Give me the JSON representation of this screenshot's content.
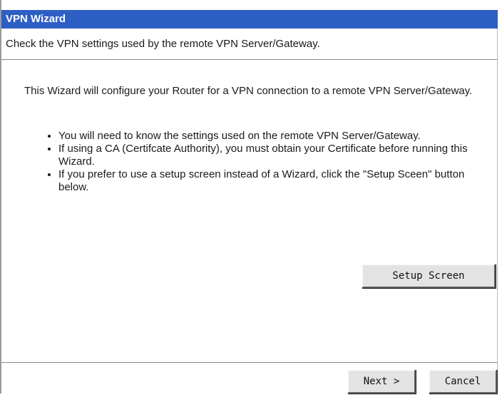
{
  "window": {
    "title": "VPN Wizard",
    "subtitle": "Check the VPN settings used by the remote VPN Server/Gateway."
  },
  "main": {
    "intro": "This Wizard will configure your Router for a VPN connection to a remote VPN Server/Gateway.",
    "bullets": [
      {
        "text": "You will need to know the settings used on the remote VPN Server/Gateway."
      },
      {
        "text": "If using a CA (Certifcate Authority), you must obtain your Certificate before running this Wizard."
      },
      {
        "text": "If you prefer to use a setup screen instead of a Wizard, click the \"Setup Sceen\" button below."
      }
    ],
    "setup_button_label": "Setup Screen"
  },
  "footer": {
    "next_label": "Next >",
    "cancel_label": "Cancel"
  },
  "colors": {
    "titlebar_bg": "#2e5fc4",
    "titlebar_text": "#ffffff",
    "button_face": "#e3e3e3"
  }
}
